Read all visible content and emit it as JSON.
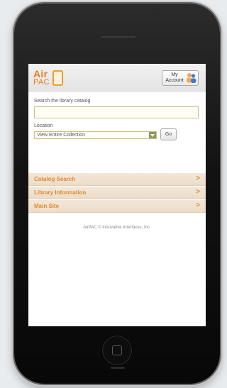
{
  "app": {
    "logo_top": "Air",
    "logo_bottom": "PAC"
  },
  "header": {
    "account_line1": "My",
    "account_line2": "Account",
    "account_icon": "people-icon"
  },
  "search": {
    "label": "Search the library catalog",
    "value": "",
    "placeholder": ""
  },
  "location": {
    "label": "Location",
    "selected": "View Entire Collection"
  },
  "go_label": "Go",
  "menu": {
    "items": [
      {
        "label": "Catalog Search",
        "icon": "chevron-right-icon"
      },
      {
        "label": "Library Information",
        "icon": "chevron-right-icon"
      },
      {
        "label": "Main Site",
        "icon": "chevron-right-icon"
      }
    ],
    "chevron": ">"
  },
  "footer": {
    "text": "AirPAC © Innovative Interfaces, Inc."
  },
  "colors": {
    "accent": "#e28a2e",
    "menu_bg": "#f4e7d8",
    "field_border": "#c9c089",
    "select_arrow": "#8a9a5a"
  }
}
